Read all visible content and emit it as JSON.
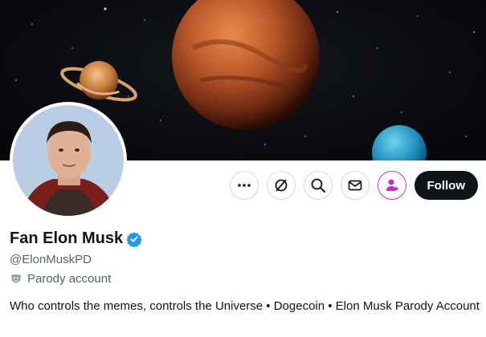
{
  "profile": {
    "display_name": "Fan Elon Musk",
    "handle": "@ElonMuskPD",
    "label": "Parody account",
    "bio": "Who controls the memes, controls the Universe • Dogecoin • Elon Musk Parody Account",
    "verified": true
  },
  "actions": {
    "more_icon": "more-icon",
    "grok_icon": "grok-icon",
    "search_icon": "search-icon",
    "message_icon": "message-icon",
    "notify_icon": "notification-person-icon",
    "follow_label": "Follow"
  },
  "colors": {
    "text_primary": "#0f1419",
    "text_secondary": "#536471",
    "verified_blue": "#1d9bf0",
    "follow_bg": "#0f1419",
    "notify_accent": "#c92fbf",
    "banner_bg": "#0a0c10"
  }
}
